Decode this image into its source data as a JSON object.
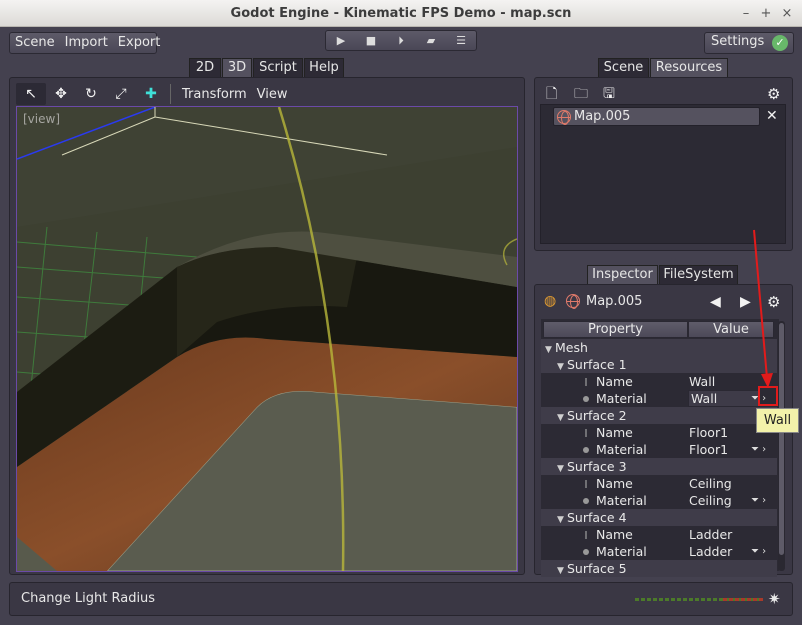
{
  "window": {
    "title": "Godot Engine - Kinematic FPS Demo - map.scn",
    "min": "–",
    "max": "+",
    "close": "×"
  },
  "menu": {
    "scene": "Scene",
    "import": "Import",
    "export": "Export"
  },
  "playbar": {
    "play": "▶",
    "stop": "■",
    "play_scene": "⏵",
    "play_custom": "▰",
    "debug": "☰"
  },
  "settings": {
    "label": "Settings",
    "check": "✓"
  },
  "main_tabs": [
    "2D",
    "3D",
    "Script",
    "Help"
  ],
  "main_tab_active": "3D",
  "viewport_toolbar": {
    "select": "↖",
    "move": "✥",
    "rotate": "↻",
    "scale": "⤢",
    "add": "✚",
    "transform": "Transform",
    "view": "View"
  },
  "viewport": {
    "label": "[view]"
  },
  "top_right_tabs": [
    "Scene",
    "Resources"
  ],
  "top_right_tab_active": "Resources",
  "resources": {
    "icons": {
      "new": "🗋",
      "open": "🗀",
      "save": "🖫",
      "gear": "⚙"
    },
    "item": "Map.005",
    "remove": "✕"
  },
  "bottom_right_tabs": [
    "Inspector",
    "FileSystem"
  ],
  "bottom_right_tab_active": "Inspector",
  "inspector": {
    "object": "Map.005",
    "prev": "◀",
    "next": "▶",
    "gear": "⚙",
    "col_property": "Property",
    "col_value": "Value",
    "rows": [
      {
        "kind": "cat",
        "indent": 0,
        "label": "Mesh"
      },
      {
        "kind": "cat",
        "indent": 1,
        "label": "Surface 1"
      },
      {
        "kind": "name",
        "label": "Name",
        "value": "Wall"
      },
      {
        "kind": "mat",
        "label": "Material",
        "value": "Wall",
        "highlight": true
      },
      {
        "kind": "cat",
        "indent": 1,
        "label": "Surface 2"
      },
      {
        "kind": "name",
        "label": "Name",
        "value": "Floor1"
      },
      {
        "kind": "mat",
        "label": "Material",
        "value": "Floor1"
      },
      {
        "kind": "cat",
        "indent": 1,
        "label": "Surface 3"
      },
      {
        "kind": "name",
        "label": "Name",
        "value": "Ceiling"
      },
      {
        "kind": "mat",
        "label": "Material",
        "value": "Ceiling"
      },
      {
        "kind": "cat",
        "indent": 1,
        "label": "Surface 4"
      },
      {
        "kind": "name",
        "label": "Name",
        "value": "Ladder"
      },
      {
        "kind": "mat",
        "label": "Material",
        "value": "Ladder"
      },
      {
        "kind": "cat",
        "indent": 1,
        "label": "Surface 5"
      }
    ],
    "tooltip": "Wall"
  },
  "status": {
    "text": "Change Light Radius",
    "spinner": "✷"
  },
  "colors": {
    "accent_red": "#e21b1b",
    "viewport_border": "#6b4aa8",
    "tooltip_bg": "#f3f2aa"
  }
}
